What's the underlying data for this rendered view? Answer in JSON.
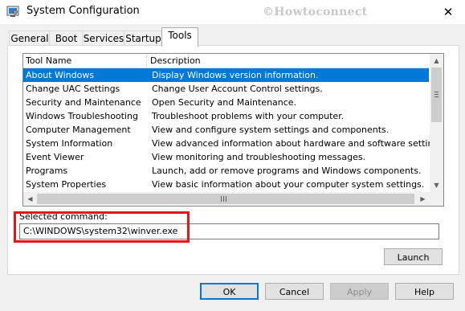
{
  "window": {
    "title": "System Configuration",
    "watermark": "©Howtoconnect",
    "close_glyph": "✕"
  },
  "tabs": [
    {
      "label": "General",
      "active": false
    },
    {
      "label": "Boot",
      "active": false
    },
    {
      "label": "Services",
      "active": false
    },
    {
      "label": "Startup",
      "active": false
    },
    {
      "label": "Tools",
      "active": true
    }
  ],
  "tools_list": {
    "columns": [
      "Tool Name",
      "Description"
    ],
    "selected_index": 0,
    "rows": [
      [
        "About Windows",
        "Display Windows version information."
      ],
      [
        "Change UAC Settings",
        "Change User Account Control settings."
      ],
      [
        "Security and Maintenance",
        "Open Security and Maintenance."
      ],
      [
        "Windows Troubleshooting",
        "Troubleshoot problems with your computer."
      ],
      [
        "Computer Management",
        "View and configure system settings and components."
      ],
      [
        "System Information",
        "View advanced information about hardware and software settings."
      ],
      [
        "Event Viewer",
        "View monitoring and troubleshooting messages."
      ],
      [
        "Programs",
        "Launch, add or remove programs and Windows components."
      ],
      [
        "System Properties",
        "View basic information about your computer system settings."
      ]
    ],
    "hscroll_grip": "III"
  },
  "selected_command": {
    "label": "Selected command:",
    "value": "C:\\WINDOWS\\system32\\winver.exe"
  },
  "buttons": {
    "launch": "Launch",
    "ok": "OK",
    "cancel": "Cancel",
    "apply": "Apply",
    "help": "Help"
  },
  "colors": {
    "selection": "#0078d7",
    "highlight_box": "#e8141c"
  }
}
